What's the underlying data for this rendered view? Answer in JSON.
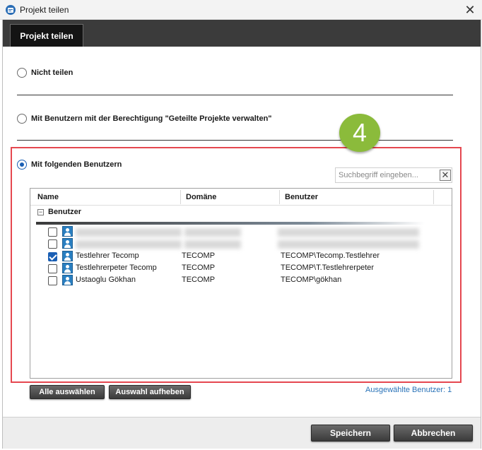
{
  "window": {
    "title": "Projekt teilen",
    "close_glyph": "✕",
    "app_icon": "project-app-icon"
  },
  "tab": {
    "label": "Projekt teilen"
  },
  "options": {
    "none": "Nicht teilen",
    "permission": "Mit Benutzern mit der Berechtigung \"Geteilte Projekte verwalten\"",
    "users": "Mit folgenden Benutzern",
    "selected": "users"
  },
  "badge": {
    "number": "4",
    "color": "#8bbb3b"
  },
  "search": {
    "placeholder": "Suchbegriff eingeben...",
    "value": "",
    "clear_glyph": "✕"
  },
  "grid": {
    "columns": [
      "Name",
      "Domäne",
      "Benutzer"
    ],
    "group": {
      "label": "Benutzer",
      "toggle_glyph": "−"
    },
    "rows": [
      {
        "name": "",
        "domain": "",
        "user": "",
        "checked": false,
        "redacted": true
      },
      {
        "name": "",
        "domain": "",
        "user": "",
        "checked": false,
        "redacted": true
      },
      {
        "name": "Testlehrer Tecomp",
        "domain": "TECOMP",
        "user": "TECOMP\\Tecomp.Testlehrer",
        "checked": true
      },
      {
        "name": "Testlehrerpeter Tecomp",
        "domain": "TECOMP",
        "user": "TECOMP\\T.Testlehrerpeter",
        "checked": false
      },
      {
        "name": "Ustaoglu Gökhan",
        "domain": "TECOMP",
        "user": "TECOMP\\gökhan",
        "checked": false
      }
    ]
  },
  "actions": {
    "select_all": "Alle auswählen",
    "deselect": "Auswahl aufheben"
  },
  "status": {
    "selected_users": "Ausgewählte Benutzer: 1"
  },
  "footer": {
    "save": "Speichern",
    "cancel": "Abbrechen"
  },
  "colors": {
    "accent": "#1a5fb4",
    "highlight": "#e5474f",
    "link": "#2a73b8",
    "tab_bg": "#3b3b3b"
  }
}
